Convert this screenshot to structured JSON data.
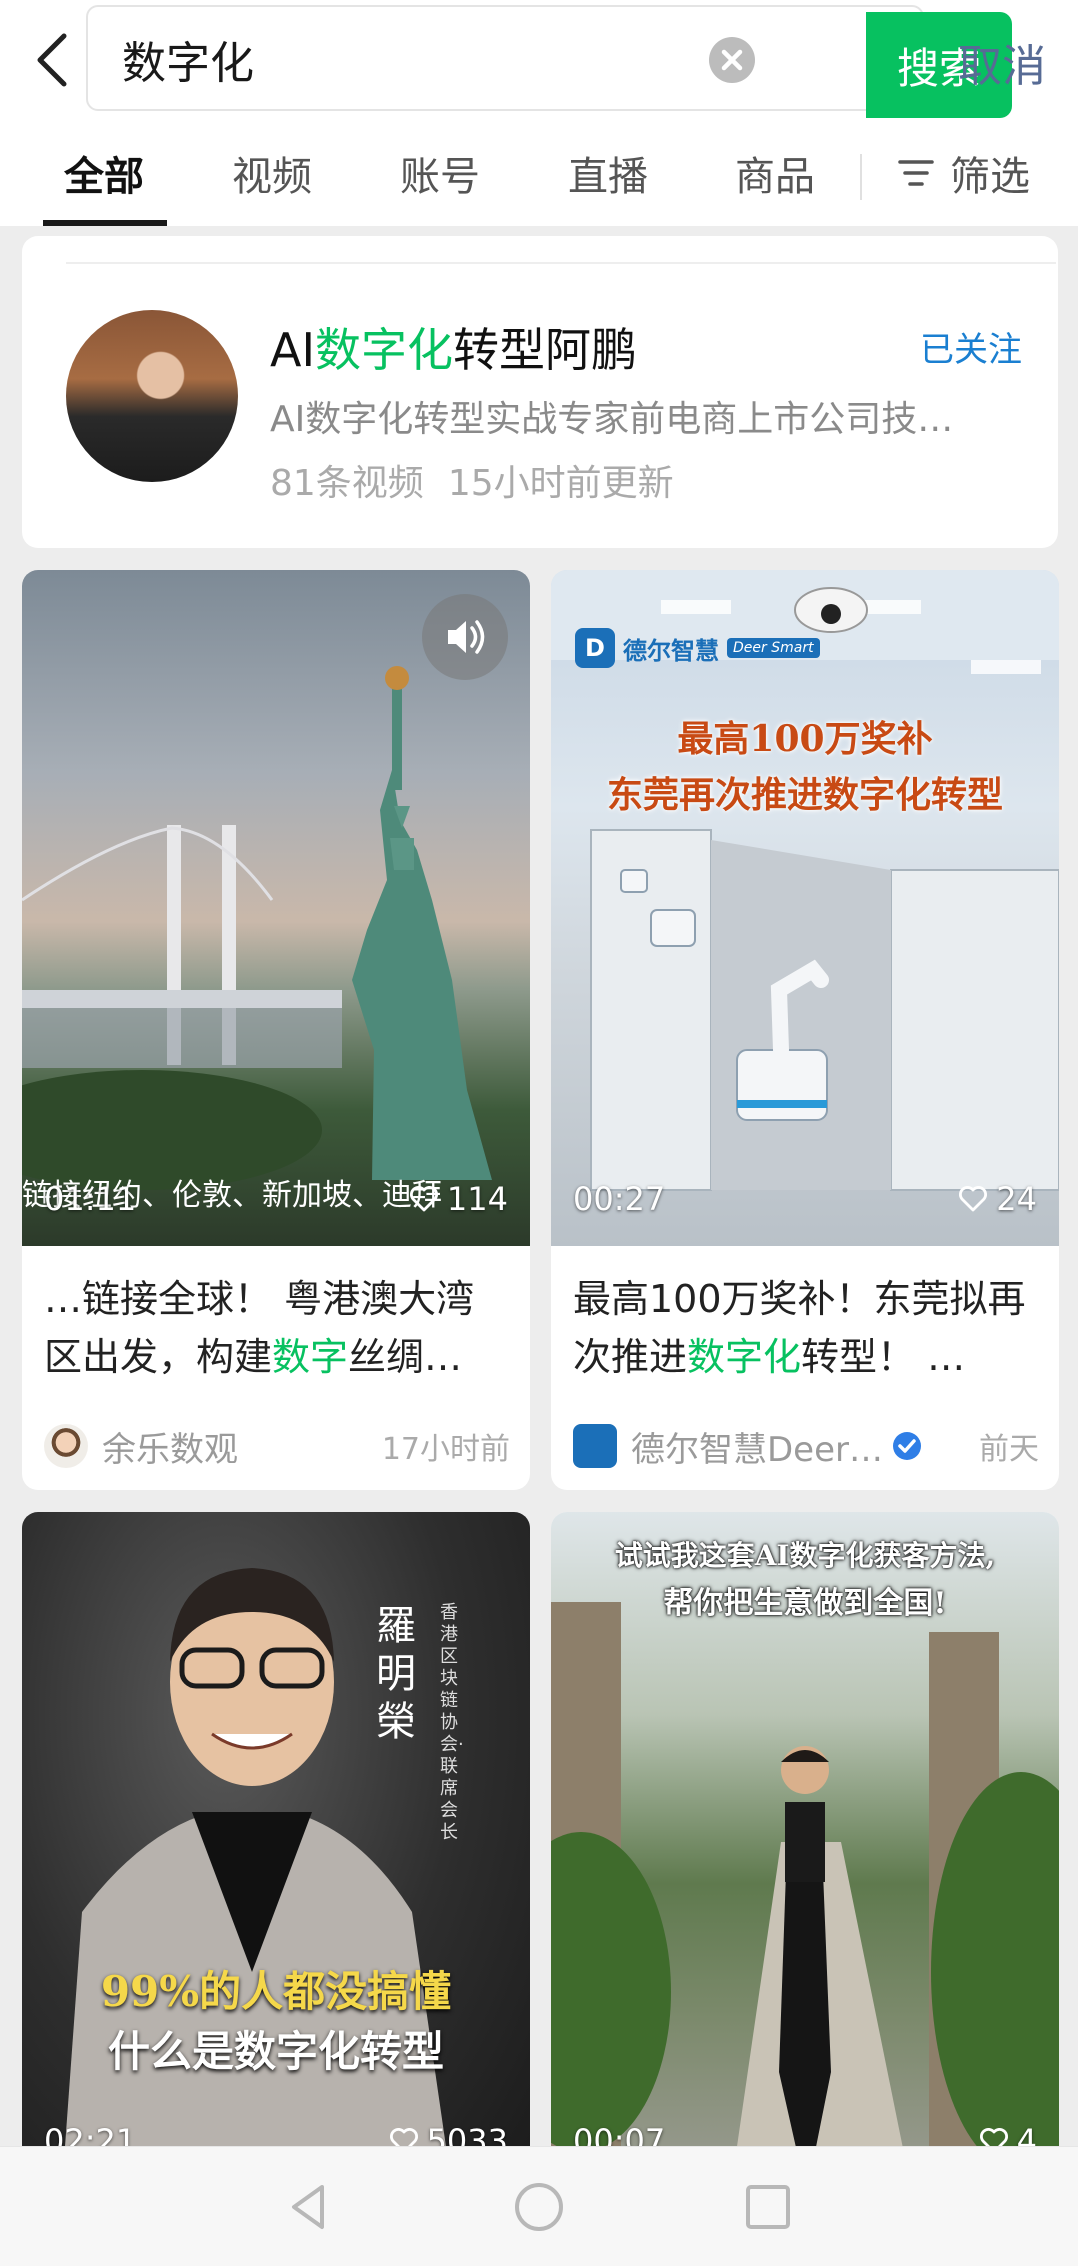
{
  "search": {
    "query": "数字化",
    "button": "搜索",
    "cancel": "取消"
  },
  "tabs": [
    "全部",
    "视频",
    "账号",
    "直播",
    "商品"
  ],
  "filter_label": "筛选",
  "account": {
    "name_pre": "AI",
    "name_hl": "数字化",
    "name_post": "转型阿鹏",
    "follow": "已关注",
    "desc": "AI数字化转型实战专家前电商上市公司技…",
    "videos": "81条视频",
    "updated": "15小时前更新"
  },
  "videos": [
    {
      "duration": "01:11",
      "likes": "114",
      "overlay": "链接纽约、伦敦、新加坡、迪拜",
      "title_pre": "…链接全球！ 粤港澳大湾区出发，构建",
      "title_hl": "数字",
      "title_post": "丝绸…",
      "author": "余乐数观",
      "time": "17小时前"
    },
    {
      "duration": "00:27",
      "likes": "24",
      "brand": "德尔智慧",
      "brand_en": "Deer Smart",
      "overlay_line1": "最高100万奖补",
      "overlay_line2": "东莞再次推进数字化转型",
      "title_pre": "最高100万奖补！东莞拟再次推进",
      "title_hl": "数字化",
      "title_post": "转型！ …",
      "author": "德尔智慧Deer…",
      "time": "前天"
    },
    {
      "duration": "02:21",
      "likes": "5033",
      "name_vertical": "羅明榮",
      "role_vertical": "香港区块链协会·联席会长",
      "overlay_line1": "99%的人都没搞懂",
      "overlay_line2": "什么是数字化转型"
    },
    {
      "duration": "00:07",
      "likes": "4",
      "overlay_line1": "试试我这套AI数字化获客方法,",
      "overlay_line2": "帮你把生意做到全国!"
    }
  ],
  "colors": {
    "accent": "#07c160",
    "link": "#1a7fd1"
  }
}
